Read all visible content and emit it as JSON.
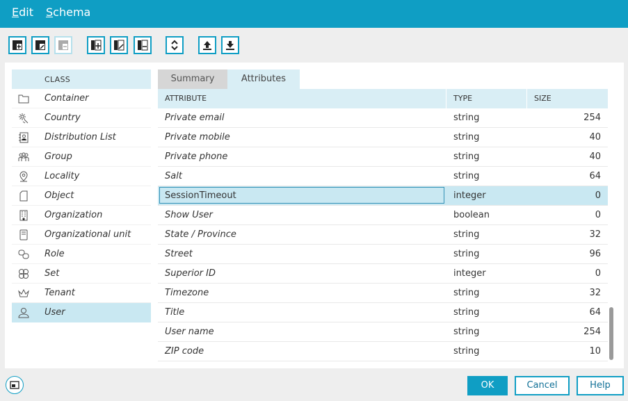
{
  "menu": {
    "edit_accel": "E",
    "edit_rest": "dit",
    "schema_accel": "S",
    "schema_rest": "chema"
  },
  "toolbar": {
    "buttons": [
      {
        "icon": "add-class-icon"
      },
      {
        "icon": "edit-class-icon"
      },
      {
        "icon": "remove-class-icon"
      },
      {
        "icon": "add-attribute-icon"
      },
      {
        "icon": "edit-attribute-icon"
      },
      {
        "icon": "remove-attribute-icon"
      },
      {
        "icon": "sort-icon"
      },
      {
        "icon": "upload-icon"
      },
      {
        "icon": "download-icon"
      }
    ]
  },
  "class_panel": {
    "header": "CLASS",
    "items": [
      {
        "label": "Container",
        "icon": "folder-icon"
      },
      {
        "label": "Country",
        "icon": "country-icon"
      },
      {
        "label": "Distribution List",
        "icon": "distribution-list-icon"
      },
      {
        "label": "Group",
        "icon": "group-icon"
      },
      {
        "label": "Locality",
        "icon": "location-pin-icon"
      },
      {
        "label": "Object",
        "icon": "object-icon"
      },
      {
        "label": "Organization",
        "icon": "building-icon"
      },
      {
        "label": "Organizational unit",
        "icon": "org-unit-icon"
      },
      {
        "label": "Role",
        "icon": "role-icon"
      },
      {
        "label": "Set",
        "icon": "set-icon"
      },
      {
        "label": "Tenant",
        "icon": "crown-icon"
      },
      {
        "label": "User",
        "icon": "user-icon"
      }
    ],
    "selected": "User"
  },
  "tabs": {
    "summary": "Summary",
    "attributes": "Attributes"
  },
  "table": {
    "headers": {
      "attribute": "ATTRIBUTE",
      "type": "TYPE",
      "size": "SIZE"
    },
    "rows": [
      {
        "name": "Private email",
        "type": "string",
        "size": "254"
      },
      {
        "name": "Private mobile",
        "type": "string",
        "size": "40"
      },
      {
        "name": "Private phone",
        "type": "string",
        "size": "40"
      },
      {
        "name": "Salt",
        "type": "string",
        "size": "64"
      },
      {
        "name": "SessionTimeout",
        "type": "integer",
        "size": "0"
      },
      {
        "name": "Show User",
        "type": "boolean",
        "size": "0"
      },
      {
        "name": "State / Province",
        "type": "string",
        "size": "32"
      },
      {
        "name": "Street",
        "type": "string",
        "size": "96"
      },
      {
        "name": "Superior ID",
        "type": "integer",
        "size": "0"
      },
      {
        "name": "Timezone",
        "type": "string",
        "size": "32"
      },
      {
        "name": "Title",
        "type": "string",
        "size": "64"
      },
      {
        "name": "User name",
        "type": "string",
        "size": "254"
      },
      {
        "name": "ZIP code",
        "type": "string",
        "size": "10"
      }
    ],
    "selected_row": "SessionTimeout"
  },
  "footer": {
    "ok": "OK",
    "cancel": "Cancel",
    "help": "Help",
    "status_icon": "window-icon"
  },
  "colors": {
    "accent": "#0f9ec4",
    "selection": "#c9e8f2",
    "header_bg": "#d9eef5"
  }
}
